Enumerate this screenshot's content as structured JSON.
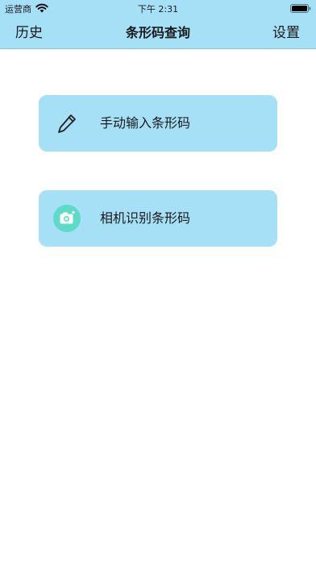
{
  "status_bar": {
    "carrier": "运营商",
    "time": "下午 2:31"
  },
  "nav": {
    "left_label": "历史",
    "title": "条形码查询",
    "right_label": "设置"
  },
  "actions": [
    {
      "label": "手动输入条形码",
      "icon": "pencil-icon"
    },
    {
      "label": "相机识别条形码",
      "icon": "camera-icon"
    }
  ],
  "colors": {
    "header_bg": "#a6e0f7",
    "card_bg": "#a6e0f7",
    "camera_icon_bg": "#5ddbc6"
  }
}
